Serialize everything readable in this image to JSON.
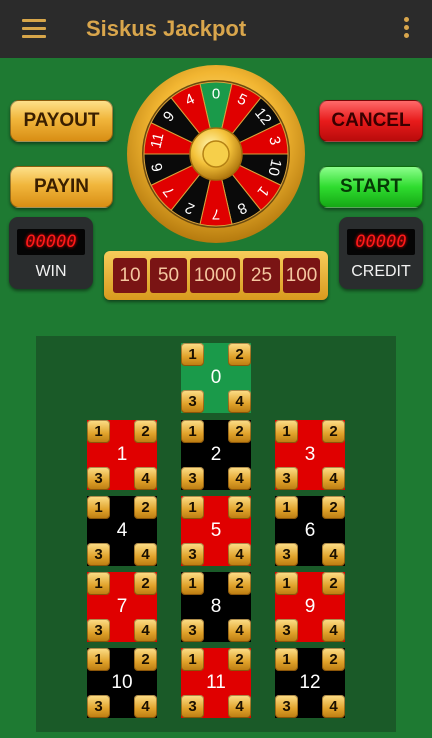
{
  "app": {
    "title": "Siskus Jackpot"
  },
  "icons": {
    "menu": "menu-icon",
    "overflow": "more-vert-icon"
  },
  "colors": {
    "felt": "#1e7a32",
    "board": "#1a5a28",
    "red": "#e00000",
    "black": "#000000",
    "green": "#1a9a4a",
    "gold": "#f1b63c"
  },
  "buttons": {
    "payout": "PAYOUT",
    "payin": "PAYIN",
    "cancel": "CANCEL",
    "start": "START"
  },
  "counters": {
    "win": {
      "value": "00000",
      "label": "WIN"
    },
    "credit": {
      "value": "00000",
      "label": "CREDIT"
    }
  },
  "chips": [
    "10",
    "50",
    "1000",
    "25",
    "100"
  ],
  "wheel": {
    "numbers": [
      "0",
      "5",
      "12",
      "3",
      "10",
      "1",
      "8",
      "7",
      "2",
      "7",
      "6",
      "11",
      "9",
      "4"
    ],
    "colors": [
      "green",
      "red",
      "black",
      "red",
      "black",
      "red",
      "black",
      "red",
      "black",
      "red",
      "black",
      "red",
      "black",
      "red"
    ]
  },
  "board": {
    "bet_tokens": [
      "1",
      "2",
      "3",
      "4"
    ],
    "zero": {
      "label": "0",
      "color": "green"
    },
    "cells": [
      {
        "label": "1",
        "color": "red"
      },
      {
        "label": "2",
        "color": "black"
      },
      {
        "label": "3",
        "color": "red"
      },
      {
        "label": "4",
        "color": "black"
      },
      {
        "label": "5",
        "color": "red"
      },
      {
        "label": "6",
        "color": "black"
      },
      {
        "label": "7",
        "color": "red"
      },
      {
        "label": "8",
        "color": "black"
      },
      {
        "label": "9",
        "color": "red"
      },
      {
        "label": "10",
        "color": "black"
      },
      {
        "label": "11",
        "color": "red"
      },
      {
        "label": "12",
        "color": "black"
      }
    ]
  }
}
